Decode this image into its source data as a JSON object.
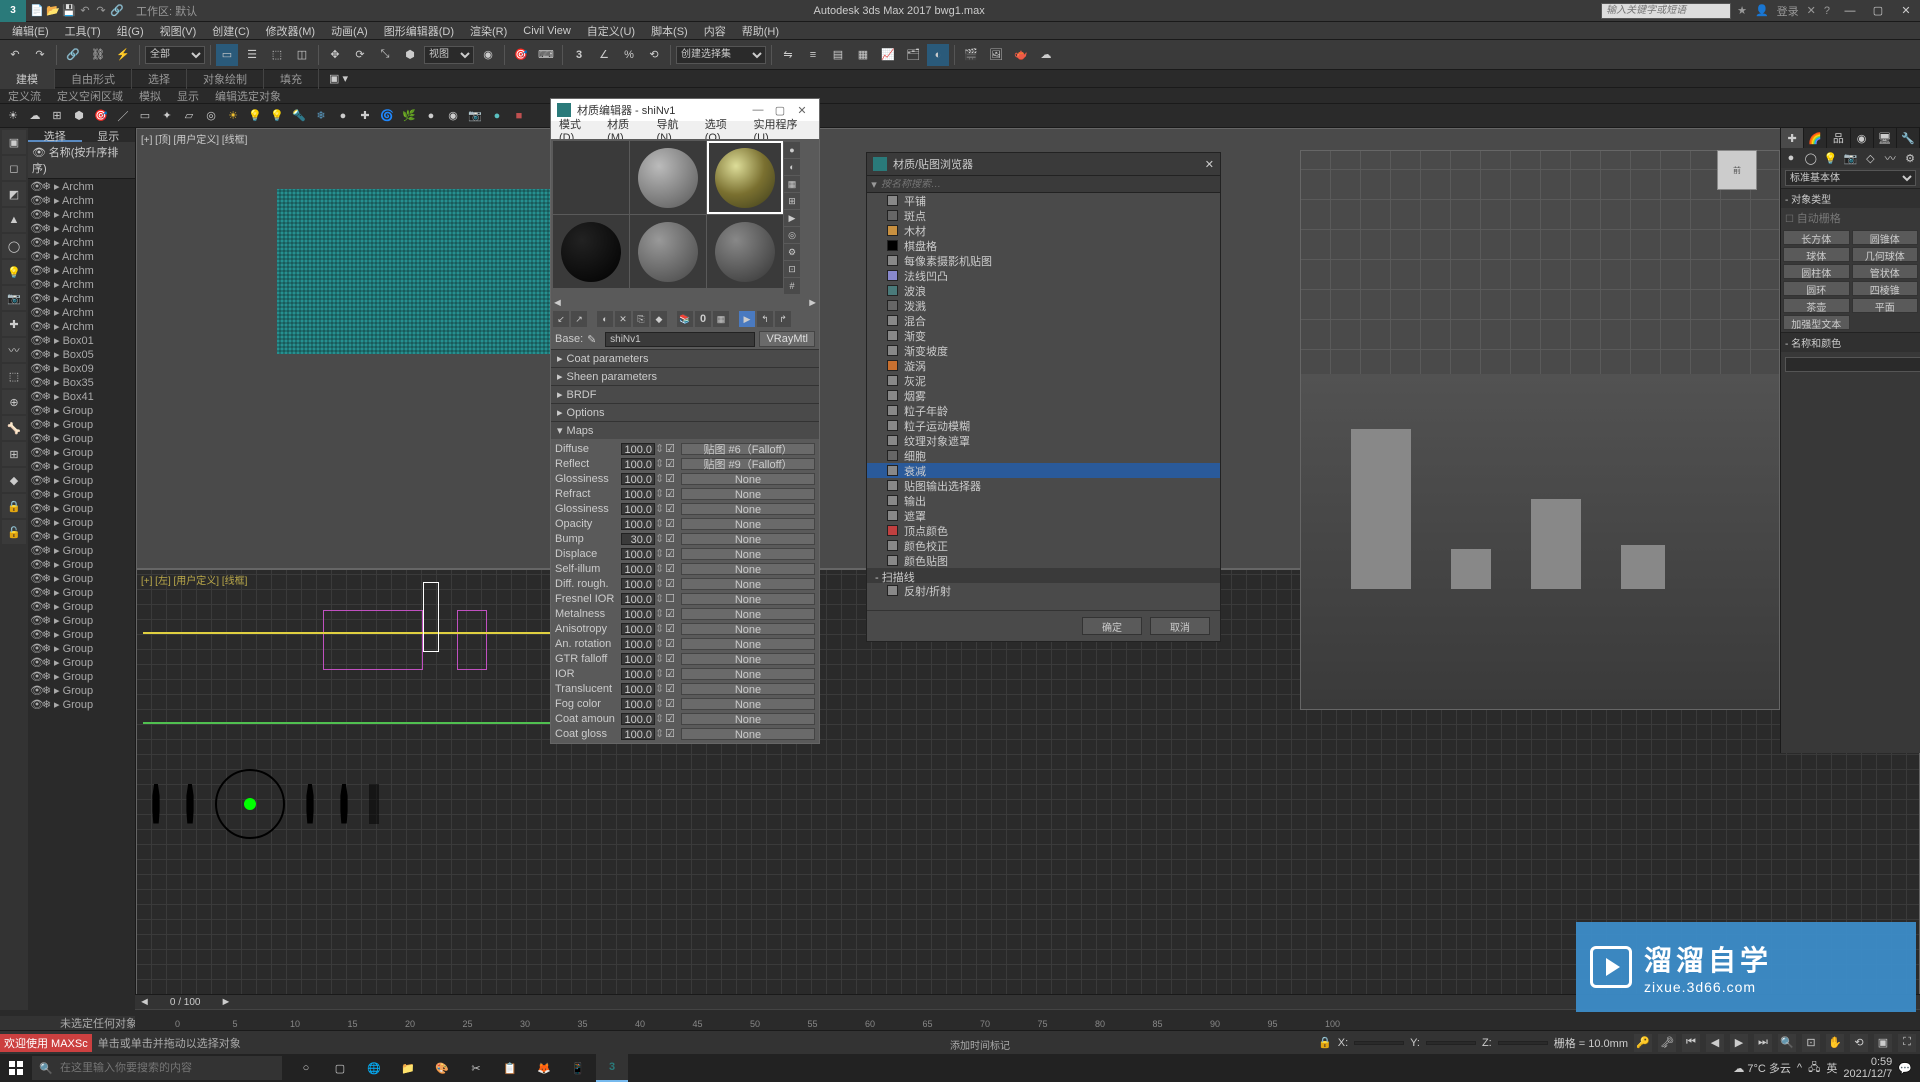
{
  "app": {
    "title": "Autodesk 3ds Max 2017    bwg1.max",
    "logo": "3",
    "workspace_label": "工作区: 默认",
    "search_placeholder": "输入关键字或短语",
    "login": "登录"
  },
  "menu": [
    "编辑(E)",
    "工具(T)",
    "组(G)",
    "视图(V)",
    "创建(C)",
    "修改器(M)",
    "动画(A)",
    "图形编辑器(D)",
    "渲染(R)",
    "Civil View",
    "自定义(U)",
    "脚本(S)",
    "内容",
    "帮助(H)"
  ],
  "toolbar": {
    "filter": "全部",
    "view": "视图",
    "selset": "创建选择集"
  },
  "ribbon_tabs": [
    "建模",
    "自由形式",
    "选择",
    "对象绘制",
    "填充"
  ],
  "subribbon": [
    "定义流",
    "定义空闲区域",
    "模拟",
    "显示",
    "编辑选定对象"
  ],
  "scene": {
    "tabs": [
      "选择",
      "显示"
    ],
    "header": "名称(按升序排序)",
    "items": [
      "Archm",
      "Archm",
      "Archm",
      "Archm",
      "Archm",
      "Archm",
      "Archm",
      "Archm",
      "Archm",
      "Archm",
      "Archm",
      "Box01",
      "Box05",
      "Box09",
      "Box35",
      "Box41",
      "Group",
      "Group",
      "Group",
      "Group",
      "Group",
      "Group",
      "Group",
      "Group",
      "Group",
      "Group",
      "Group",
      "Group",
      "Group",
      "Group",
      "Group",
      "Group",
      "Group",
      "Group",
      "Group",
      "Group",
      "Group",
      "Group"
    ]
  },
  "viewports": {
    "top": "[+] [顶] [用户定义] [线框]",
    "left": "[+] [左] [用户定义] [线框]"
  },
  "mat_editor": {
    "title": "材质编辑器 - shiNv1",
    "menu": [
      "模式(D)",
      "材质(M)",
      "导航(N)",
      "选项(O)",
      "实用程序(U)"
    ],
    "base_label": "Base:",
    "material_name": "shiNv1",
    "material_type": "VRayMtl",
    "rollouts": [
      "Coat parameters",
      "Sheen parameters",
      "BRDF",
      "Options",
      "Maps"
    ],
    "maps": [
      {
        "name": "Diffuse",
        "val": "100.0",
        "chk": true,
        "btn": "贴图 #6（Falloff）"
      },
      {
        "name": "Reflect",
        "val": "100.0",
        "chk": true,
        "btn": "贴图 #9（Falloff）"
      },
      {
        "name": "Glossiness",
        "val": "100.0",
        "chk": true,
        "btn": "None"
      },
      {
        "name": "Refract",
        "val": "100.0",
        "chk": true,
        "btn": "None"
      },
      {
        "name": "Glossiness",
        "val": "100.0",
        "chk": true,
        "btn": "None"
      },
      {
        "name": "Opacity",
        "val": "100.0",
        "chk": true,
        "btn": "None"
      },
      {
        "name": "Bump",
        "val": "30.0",
        "chk": true,
        "btn": "None"
      },
      {
        "name": "Displace",
        "val": "100.0",
        "chk": true,
        "btn": "None"
      },
      {
        "name": "Self-illum",
        "val": "100.0",
        "chk": true,
        "btn": "None"
      },
      {
        "name": "Diff. rough.",
        "val": "100.0",
        "chk": true,
        "btn": "None"
      },
      {
        "name": "Fresnel IOR",
        "val": "100.0",
        "chk": false,
        "btn": "None"
      },
      {
        "name": "Metalness",
        "val": "100.0",
        "chk": true,
        "btn": "None"
      },
      {
        "name": "Anisotropy",
        "val": "100.0",
        "chk": true,
        "btn": "None"
      },
      {
        "name": "An. rotation",
        "val": "100.0",
        "chk": true,
        "btn": "None"
      },
      {
        "name": "GTR falloff",
        "val": "100.0",
        "chk": true,
        "btn": "None"
      },
      {
        "name": "IOR",
        "val": "100.0",
        "chk": true,
        "btn": "None"
      },
      {
        "name": "Translucent",
        "val": "100.0",
        "chk": true,
        "btn": "None"
      },
      {
        "name": "Fog color",
        "val": "100.0",
        "chk": true,
        "btn": "None"
      },
      {
        "name": "Coat amoun",
        "val": "100.0",
        "chk": true,
        "btn": "None"
      },
      {
        "name": "Coat gloss",
        "val": "100.0",
        "chk": true,
        "btn": "None"
      }
    ]
  },
  "browser": {
    "title": "材质/贴图浏览器",
    "search": "按名称搜索…",
    "items": [
      {
        "name": "平铺",
        "color": "#888"
      },
      {
        "name": "斑点",
        "color": "#666"
      },
      {
        "name": "木材",
        "color": "#c89040"
      },
      {
        "name": "棋盘格",
        "color": "#000"
      },
      {
        "name": "每像素摄影机贴图",
        "color": "#888"
      },
      {
        "name": "法线凹凸",
        "color": "#8888cc"
      },
      {
        "name": "波浪",
        "color": "#4a7a7a"
      },
      {
        "name": "泼溅",
        "color": "#666"
      },
      {
        "name": "混合",
        "color": "#888"
      },
      {
        "name": "渐变",
        "color": "#888"
      },
      {
        "name": "渐变坡度",
        "color": "#888"
      },
      {
        "name": "漩涡",
        "color": "#c87030"
      },
      {
        "name": "灰泥",
        "color": "#888"
      },
      {
        "name": "烟雾",
        "color": "#888"
      },
      {
        "name": "粒子年龄",
        "color": "#888"
      },
      {
        "name": "粒子运动模糊",
        "color": "#888"
      },
      {
        "name": "纹理对象遮罩",
        "color": "#888"
      },
      {
        "name": "细胞",
        "color": "#666"
      },
      {
        "name": "衰减",
        "color": "#888",
        "selected": true
      },
      {
        "name": "贴图输出选择器",
        "color": "#888"
      },
      {
        "name": "输出",
        "color": "#888"
      },
      {
        "name": "遮罩",
        "color": "#888"
      },
      {
        "name": "顶点颜色",
        "color": "#c04040"
      },
      {
        "name": "颜色校正",
        "color": "#888"
      },
      {
        "name": "颜色贴图",
        "color": "#888"
      }
    ],
    "category": "- 扫描线",
    "sub_items": [
      {
        "name": "反射/折射",
        "color": "#888"
      }
    ],
    "ok": "确定",
    "cancel": "取消"
  },
  "cmdpanel": {
    "dropdown": "标准基本体",
    "roll_objtype": "- 对象类型",
    "autogrid": "自动栅格",
    "buttons": [
      [
        "长方体",
        "圆锥体"
      ],
      [
        "球体",
        "几何球体"
      ],
      [
        "圆柱体",
        "管状体"
      ],
      [
        "圆环",
        "四棱锥"
      ],
      [
        "茶壶",
        "平面"
      ],
      [
        "加强型文本",
        ""
      ]
    ],
    "roll_namecolor": "- 名称和颜色"
  },
  "timeline": {
    "frame": "0 / 100",
    "ticks": [
      0,
      5,
      10,
      15,
      20,
      25,
      30,
      35,
      40,
      45,
      50,
      55,
      60,
      65,
      70,
      75,
      80,
      85,
      90,
      95,
      100
    ]
  },
  "status": {
    "top": "未选定任何对象",
    "welcome": "欢迎使用 MAXSc",
    "help": "单击或单击并拖动以选择对象",
    "lock": "🔒",
    "x": "X:",
    "y": "Y:",
    "z": "Z:",
    "grid": "栅格 = 10.0mm",
    "addtime": "添加时间标记"
  },
  "taskbar": {
    "search": "在这里输入你要搜索的内容",
    "weather": "7°C 多云",
    "ime": "英",
    "time": "0:59",
    "date": "2021/12/7"
  },
  "watermark": {
    "line1": "溜溜自学",
    "line2": "zixue.3d66.com"
  }
}
